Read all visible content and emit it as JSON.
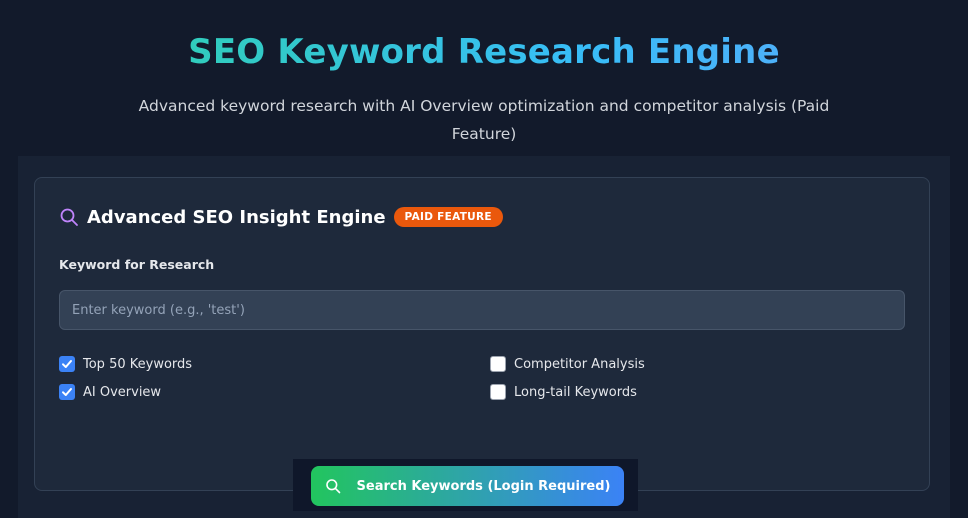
{
  "hero": {
    "title": "SEO Keyword Research Engine",
    "subtitle": "Advanced keyword research with AI Overview optimization and competitor analysis (Paid Feature)"
  },
  "card": {
    "icon": "search-icon",
    "title": "Advanced SEO Insight Engine",
    "badge": "PAID FEATURE",
    "keyword_label": "Keyword for Research",
    "keyword_value": "",
    "keyword_placeholder": "Enter keyword (e.g., 'test')",
    "options": [
      {
        "label": "Top 50 Keywords",
        "checked": true
      },
      {
        "label": "AI Overview",
        "checked": true
      },
      {
        "label": "Competitor Analysis",
        "checked": false
      },
      {
        "label": "Long-tail Keywords",
        "checked": false
      }
    ],
    "search_button_label": "Search Keywords (Login Required)",
    "search_button_icon": "search-icon"
  },
  "colors": {
    "background": "#121a2b",
    "card": "#1e293b",
    "badge": "#ea580c",
    "checkbox_checked": "#3b82f6",
    "title_gradient": [
      "#2dd4a0",
      "#60a5fa"
    ],
    "button_gradient": [
      "#22c55e",
      "#3b82f6"
    ]
  }
}
